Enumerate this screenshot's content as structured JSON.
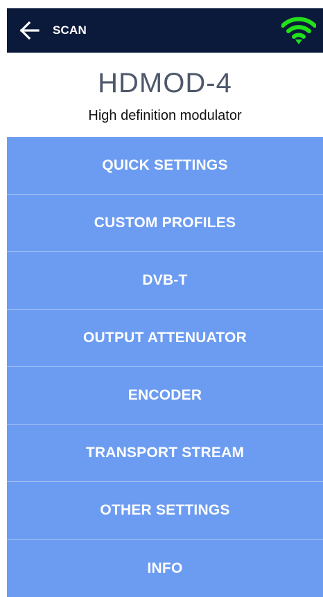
{
  "header": {
    "back_icon": "arrow-left-icon",
    "title": "SCAN",
    "status_icon": "wifi-icon",
    "status_color": "#22e01a",
    "background": "#0b1a3a"
  },
  "device": {
    "name": "HDMOD-4",
    "subtitle": "High definition modulator"
  },
  "menu": {
    "color": "#6c9cf1",
    "items": [
      {
        "label": "QUICK SETTINGS"
      },
      {
        "label": "CUSTOM PROFILES"
      },
      {
        "label": "DVB-T"
      },
      {
        "label": "OUTPUT ATTENUATOR"
      },
      {
        "label": "ENCODER"
      },
      {
        "label": "TRANSPORT STREAM"
      },
      {
        "label": "OTHER SETTINGS"
      },
      {
        "label": "INFO"
      }
    ]
  }
}
